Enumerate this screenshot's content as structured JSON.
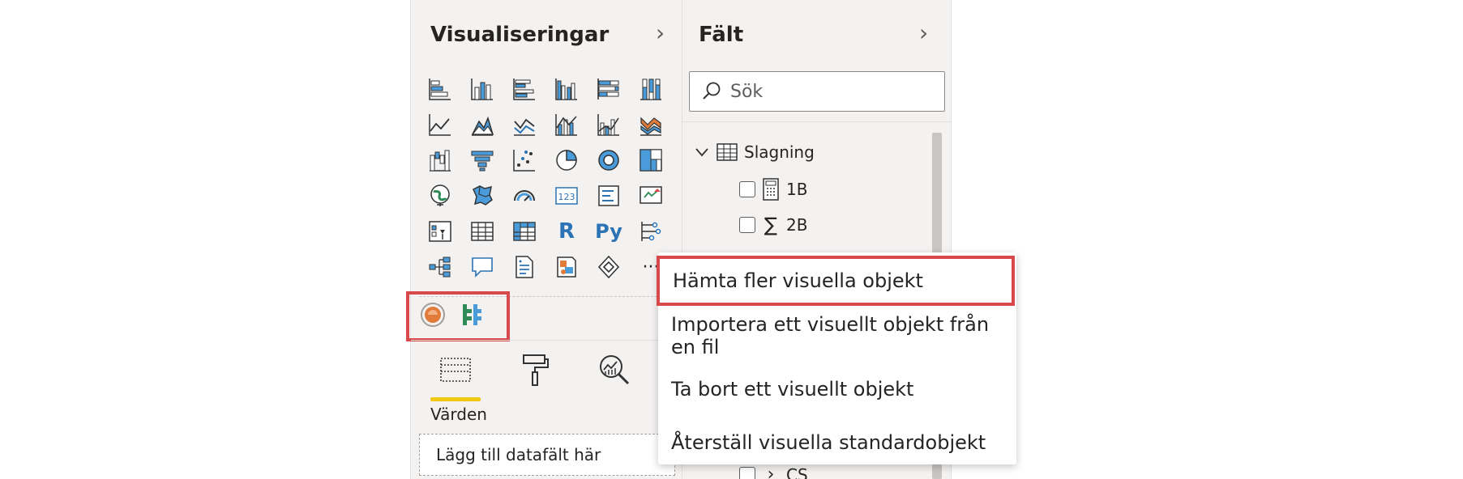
{
  "visualizations": {
    "title": "Visualiseringar",
    "values_label": "Värden",
    "drop_placeholder": "Lägg till datafält här",
    "r_label": "R",
    "py_label": "Py",
    "more_label": "···"
  },
  "fields": {
    "title": "Fält",
    "search_placeholder": "Sök",
    "table_name": "Slagning",
    "items": [
      "1B",
      "2B",
      "CS"
    ]
  },
  "context_menu": {
    "items": [
      "Hämta fler visuella objekt",
      "Importera ett visuellt objekt från en fil",
      "Ta bort ett visuellt objekt",
      "Återställ visuella standardobjekt"
    ]
  },
  "colors": {
    "highlight": "#d9484b",
    "accent_blue": "#2b73b5",
    "active_tab": "#f2c811",
    "pane_bg": "#f3f2f1"
  }
}
